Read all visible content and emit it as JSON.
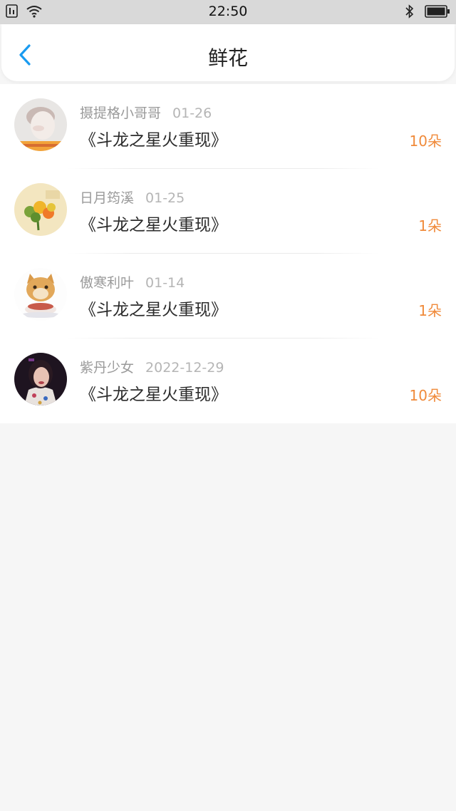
{
  "status_bar": {
    "time": "22:50",
    "icons": [
      "sim-icon",
      "wifi-icon",
      "bluetooth-icon",
      "battery-icon"
    ]
  },
  "header": {
    "title": "鲜花",
    "back_icon": "chevron-left-icon"
  },
  "colors": {
    "accent": "#1a9bf0",
    "amount": "#f08a3a"
  },
  "items": [
    {
      "name": "摄提格小哥哥",
      "date": "01-26",
      "book": "《斗龙之星火重现》",
      "amount": "10朵"
    },
    {
      "name": "日月筠溪",
      "date": "01-25",
      "book": "《斗龙之星火重现》",
      "amount": "1朵"
    },
    {
      "name": "傲寒利叶",
      "date": "01-14",
      "book": "《斗龙之星火重现》",
      "amount": "1朵"
    },
    {
      "name": "紫丹少女",
      "date": "2022-12-29",
      "book": "《斗龙之星火重现》",
      "amount": "10朵"
    }
  ]
}
